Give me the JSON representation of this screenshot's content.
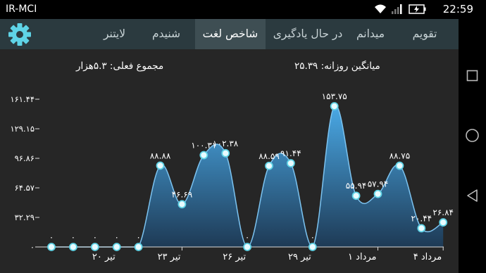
{
  "status": {
    "carrier": "IR-MCI",
    "time": "22:59"
  },
  "tabs": [
    {
      "label": "تقویم",
      "active": false
    },
    {
      "label": "میدانم",
      "active": false
    },
    {
      "label": "در حال یادگیری",
      "active": false
    },
    {
      "label": "شاخص لغت",
      "active": true
    },
    {
      "label": "شنیدم",
      "active": false
    },
    {
      "label": "لایتنر",
      "active": false
    }
  ],
  "summary": {
    "daily_average": "میانگین روزانه: ۲۵.۳۹",
    "total": "مجموع فعلی: ۵.۳هزار"
  },
  "colors": {
    "accent": "#5fd3e6",
    "appbar": "#2b3a3f",
    "active_tab": "#3e4e53",
    "background": "#262626",
    "area_top": "#4aa9e6",
    "area_bottom": "#1e3a55",
    "point_fill": "#e8fbff"
  },
  "chart_data": {
    "type": "area",
    "y_ticks": [
      "۰",
      "۳۲.۲۹",
      "۶۴.۵۷",
      "۹۶.۸۶",
      "۱۲۹.۱۵",
      "۱۶۱.۴۴"
    ],
    "ylim": [
      0,
      161.44
    ],
    "x_tick_labels": [
      "۲۰ تیر",
      "۲۳ تیر",
      "۲۶ تیر",
      "۲۹ تیر",
      "۱ مرداد",
      "۴ مرداد"
    ],
    "points": [
      {
        "value": 0,
        "label": "۰"
      },
      {
        "value": 0,
        "label": "۰"
      },
      {
        "value": 0,
        "label": "۰"
      },
      {
        "value": 0,
        "label": "۰"
      },
      {
        "value": 0,
        "label": "۰"
      },
      {
        "value": 88.88,
        "label": "۸۸.۸۸"
      },
      {
        "value": 46.69,
        "label": "۴۶.۶۹"
      },
      {
        "value": 100.31,
        "label": "۱۰۰.۳۱"
      },
      {
        "value": 102.38,
        "label": "۱۰۲.۳۸"
      },
      {
        "value": 0,
        "label": "۰"
      },
      {
        "value": 88.59,
        "label": "۸۸.۵۹"
      },
      {
        "value": 91.44,
        "label": "۹۱.۴۴"
      },
      {
        "value": 0,
        "label": "۰"
      },
      {
        "value": 153.75,
        "label": "۱۵۳.۷۵"
      },
      {
        "value": 55.94,
        "label": "۵۵.۹۴"
      },
      {
        "value": 57.94,
        "label": "۵۷.۹۴"
      },
      {
        "value": 88.75,
        "label": "۸۸.۷۵"
      },
      {
        "value": 20.44,
        "label": "۲۰.۴۴"
      },
      {
        "value": 26.84,
        "label": "۲۶.۸۴"
      }
    ]
  }
}
